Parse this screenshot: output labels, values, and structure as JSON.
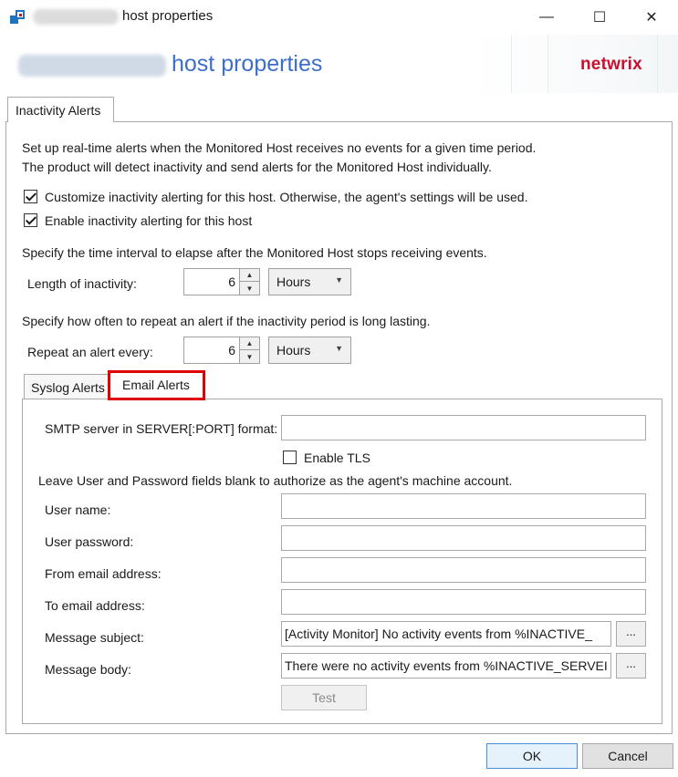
{
  "window": {
    "title": "host properties",
    "minimize_glyph": "—",
    "maximize_glyph": "☐",
    "close_glyph": "✕",
    "app_icon": "netwrix-app-icon"
  },
  "header": {
    "title": "host properties",
    "logo_text": "netwrix"
  },
  "outer_tab": {
    "label": "Inactivity Alerts"
  },
  "intro": {
    "line1": "Set up real-time alerts when the Monitored Host receives no events for a given time period.",
    "line2": "The product will detect inactivity and send alerts for the Monitored Host individually."
  },
  "checkboxes": {
    "customize": {
      "label": "Customize inactivity alerting for this host. Otherwise, the agent's settings will be used.",
      "checked": true
    },
    "enable": {
      "label": "Enable inactivity alerting for this host",
      "checked": true
    }
  },
  "inactivity": {
    "hint": "Specify the time interval to elapse after the Monitored Host stops receiving events.",
    "label": "Length of inactivity:",
    "value": "6",
    "unit": "Hours"
  },
  "repeat": {
    "hint": "Specify how often to repeat an alert if the inactivity period is long lasting.",
    "label": "Repeat an alert every:",
    "value": "6",
    "unit": "Hours"
  },
  "inner_tabs": [
    {
      "label": "Syslog Alerts",
      "active": false
    },
    {
      "label": "Email Alerts",
      "active": true
    }
  ],
  "email": {
    "smtp_label": "SMTP server in SERVER[:PORT] format:",
    "smtp_value": "",
    "tls_label": "Enable TLS",
    "tls_checked": false,
    "note": "Leave User and Password fields blank to authorize as the agent's machine account.",
    "user_label": "User name:",
    "user_value": "",
    "password_label": "User password:",
    "password_value": "",
    "from_label": "From email address:",
    "from_value": "",
    "to_label": "To email address:",
    "to_value": "",
    "subject_label": "Message subject:",
    "subject_value": "[Activity Monitor] No activity events from %INACTIVE_",
    "body_label": "Message body:",
    "body_value": "There were no activity events from %INACTIVE_SERVEI",
    "ellipsis": "...",
    "test_label": "Test"
  },
  "footer": {
    "ok_label": "OK",
    "cancel_label": "Cancel"
  }
}
